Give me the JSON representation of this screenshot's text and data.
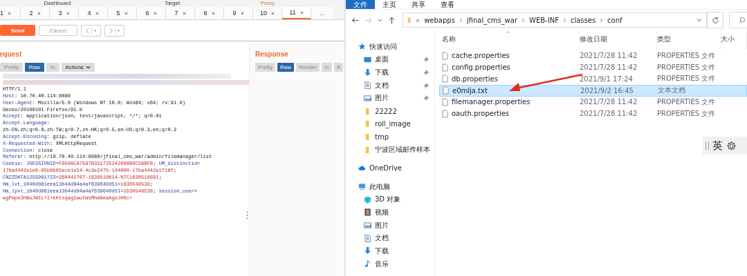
{
  "burp": {
    "main_tabs": [
      {
        "label": "Dashboard",
        "selected": false
      },
      {
        "label": "Target",
        "selected": false
      },
      {
        "label": "Proxy",
        "selected": true
      }
    ],
    "repeater_tabs": [
      {
        "label": "1",
        "kind": "tab",
        "selected": false
      },
      {
        "label": "2",
        "kind": "tab",
        "selected": false
      },
      {
        "label": "3",
        "kind": "tab",
        "selected": false
      },
      {
        "label": "4",
        "kind": "tab",
        "selected": false
      },
      {
        "label": "5",
        "kind": "tab",
        "selected": false
      },
      {
        "label": "6",
        "kind": "tab",
        "selected": false
      },
      {
        "label": "7",
        "kind": "tab",
        "selected": false
      },
      {
        "label": "8",
        "kind": "tab",
        "selected": false
      },
      {
        "label": "9",
        "kind": "tab",
        "selected": false
      },
      {
        "label": "10",
        "kind": "tab",
        "selected": false
      },
      {
        "label": "11",
        "kind": "tab",
        "selected": true
      },
      {
        "label": "...",
        "kind": "more"
      }
    ],
    "send": "Send",
    "cancel": "Cancel",
    "request": {
      "title": "equest",
      "actions": "Actions",
      "view_buttons": [
        {
          "label": "Pretty",
          "selected": false
        },
        {
          "label": "Raw",
          "selected": true
        },
        {
          "label": "\\n",
          "selected": false
        }
      ],
      "lines": [
        [
          {
            "kind": "plain",
            "text": "HTTP/1.1"
          }
        ],
        [
          {
            "kind": "name",
            "text": "Host"
          },
          {
            "kind": "plain",
            "text": ": 10.70.40.114:8080"
          }
        ],
        [
          {
            "kind": "name",
            "text": "User-Agent"
          },
          {
            "kind": "plain",
            "text": ": Mozilla/5.0 (Windows NT 10.0; Win64; x64; rv:91.0)"
          }
        ],
        [
          {
            "kind": "plain",
            "text": "Gecko/20100101 Firefox/91.0"
          }
        ],
        [
          {
            "kind": "name",
            "text": "Accept"
          },
          {
            "kind": "plain",
            "text": ": application/json, text/javascript, */*; q=0.01"
          }
        ],
        [
          {
            "kind": "name",
            "text": "Accept-Language"
          },
          {
            "kind": "plain",
            "text": ":"
          }
        ],
        [
          {
            "kind": "plain",
            "text": "zh-CN,zh;q=0.8,zh-TW;q=0.7,zh-HK;q=0.5,en-US;q=0.3,en;q=0.2"
          }
        ],
        [
          {
            "kind": "name",
            "text": "Accept-Encoding"
          },
          {
            "kind": "plain",
            "text": ": gzip, deflate"
          }
        ],
        [
          {
            "kind": "name",
            "text": "X-Requested-With"
          },
          {
            "kind": "plain",
            "text": ": XMLHttpRequest"
          }
        ],
        [
          {
            "kind": "name",
            "text": "Connection"
          },
          {
            "kind": "plain",
            "text": ": close"
          }
        ],
        [
          {
            "kind": "name",
            "text": "Referer"
          },
          {
            "kind": "plain",
            "text": ": http://10.70.40.114:8080/jfinal_cms_war/admin/filemanager/list"
          }
        ],
        [
          {
            "kind": "name",
            "text": "Cookie"
          },
          {
            "kind": "plain",
            "text": ": "
          },
          {
            "kind": "name",
            "text": "JSESSIONID"
          },
          {
            "kind": "plain",
            "text": "="
          },
          {
            "kind": "value",
            "text": "F950ACA7587B331725242608B0C58BFB"
          },
          {
            "kind": "plain",
            "text": "; "
          },
          {
            "kind": "name",
            "text": "UM_distinctid"
          },
          {
            "kind": "plain",
            "text": "="
          }
        ],
        [
          {
            "kind": "value",
            "text": "17ba4442e1e9-05b6b05ece1e54-4c3e247b-144000-17ba4442e1f18f"
          },
          {
            "kind": "plain",
            "text": ";"
          }
        ],
        [
          {
            "kind": "name",
            "text": "CNZZDATA1255091723"
          },
          {
            "kind": "plain",
            "text": "="
          },
          {
            "kind": "value",
            "text": "260441767-1630510614-%7C1630510691"
          },
          {
            "kind": "plain",
            "text": ";"
          }
        ],
        [
          {
            "kind": "name",
            "text": "Hm_lvt_1040d081eea13b44d84a4af639640d51"
          },
          {
            "kind": "plain",
            "text": "="
          },
          {
            "kind": "value",
            "text": "1630548538"
          },
          {
            "kind": "plain",
            "text": ";"
          }
        ],
        [
          {
            "kind": "name",
            "text": "Hm_lpvt_1040d081eea13b44d84a4af639640d51"
          },
          {
            "kind": "plain",
            "text": "="
          },
          {
            "kind": "value",
            "text": "1630548538"
          },
          {
            "kind": "plain",
            "text": "; "
          },
          {
            "kind": "name",
            "text": "session_user"
          },
          {
            "kind": "plain",
            "text": "="
          }
        ],
        [
          {
            "kind": "value",
            "text": "wgPmpe3hBuJWIL+I+kHtxqag1wutWsMhm6eaAgoJH0c="
          }
        ]
      ]
    },
    "response": {
      "title": "Response",
      "view_buttons": [
        {
          "label": "Pretty",
          "selected": false
        },
        {
          "label": "Raw",
          "selected": true
        },
        {
          "label": "Render",
          "selected": false
        },
        {
          "label": "\\n",
          "selected": false
        },
        {
          "label": "A",
          "selected": false
        }
      ]
    }
  },
  "explorer": {
    "ribbon_tabs": [
      {
        "label": "文件",
        "selected": true
      },
      {
        "label": "主页",
        "selected": false
      },
      {
        "label": "共享",
        "selected": false
      },
      {
        "label": "查看",
        "selected": false
      }
    ],
    "overflow": "«",
    "path": [
      "webapps",
      "jfinal_cms_war",
      "WEB-INF",
      "classes",
      "conf"
    ],
    "columns": [
      "名称",
      "修改日期",
      "类型",
      "大小"
    ],
    "files": [
      {
        "name": "cache.properties",
        "modified": "2021/7/28 11:42",
        "type": "PROPERTIES 文件",
        "selected": false
      },
      {
        "name": "config.properties",
        "modified": "2021/7/28 11:42",
        "type": "PROPERTIES 文件",
        "selected": false
      },
      {
        "name": "db.properties",
        "modified": "2021/9/1 17:24",
        "type": "PROPERTIES 文件",
        "selected": false
      },
      {
        "name": "e0mlja.txt",
        "modified": "2021/9/2 16:45",
        "type": "文本文档",
        "selected": true
      },
      {
        "name": "filemanager.properties",
        "modified": "2021/7/28 11:42",
        "type": "PROPERTIES 文件",
        "selected": false
      },
      {
        "name": "oauth.properties",
        "modified": "2021/7/28 11:42",
        "type": "PROPERTIES 文件",
        "selected": false
      }
    ],
    "nav": [
      {
        "label": "快速访问",
        "kind": "star",
        "children": [
          {
            "label": "桌面",
            "kind": "desktop",
            "pinned": true
          },
          {
            "label": "下载",
            "kind": "download",
            "pinned": true
          },
          {
            "label": "文档",
            "kind": "docs",
            "pinned": true
          },
          {
            "label": "图片",
            "kind": "pictures",
            "pinned": true
          },
          {
            "label": "22222",
            "kind": "folder",
            "pinned": false
          },
          {
            "label": "roll_image",
            "kind": "folder",
            "pinned": false
          },
          {
            "label": "tmp",
            "kind": "folder",
            "pinned": false
          },
          {
            "label": "宁波区域邮件样本",
            "kind": "folder",
            "pinned": false
          }
        ]
      },
      {
        "label": "OneDrive",
        "kind": "cloud"
      },
      {
        "label": "此电脑",
        "kind": "pc",
        "children": [
          {
            "label": "3D 对象",
            "kind": "cube",
            "pinned": false
          },
          {
            "label": "视频",
            "kind": "video",
            "pinned": false
          },
          {
            "label": "图片",
            "kind": "pictures",
            "pinned": false
          },
          {
            "label": "文档",
            "kind": "docs",
            "pinned": false
          },
          {
            "label": "下载",
            "kind": "download",
            "pinned": false
          },
          {
            "label": "音乐",
            "kind": "music",
            "pinned": false
          }
        ]
      }
    ]
  },
  "ime": {
    "label": "英"
  }
}
